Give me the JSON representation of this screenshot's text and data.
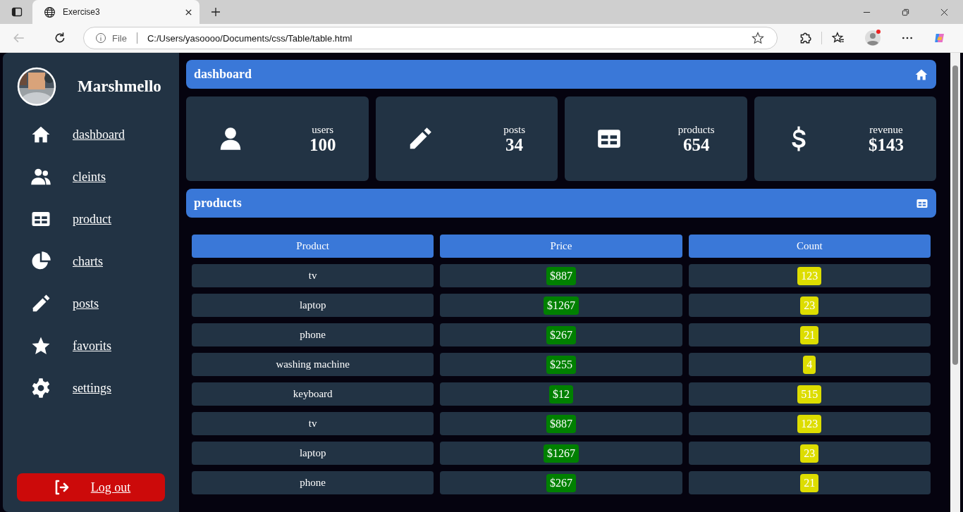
{
  "browser": {
    "tab_title": "Exercise3",
    "scheme": "File",
    "url": "C:/Users/yasoooo/Documents/css/Table/table.html"
  },
  "sidebar": {
    "user_name": "Marshmello",
    "items": [
      {
        "label": "dashboard"
      },
      {
        "label": "cleints"
      },
      {
        "label": "product"
      },
      {
        "label": "charts"
      },
      {
        "label": "posts"
      },
      {
        "label": "favorits"
      },
      {
        "label": "settings"
      }
    ],
    "logout": "Log out"
  },
  "header": {
    "title": "dashboard"
  },
  "stats": [
    {
      "label": "users",
      "value": "100"
    },
    {
      "label": "posts",
      "value": "34"
    },
    {
      "label": "products",
      "value": "654"
    },
    {
      "label": "revenue",
      "value": "$143"
    }
  ],
  "products": {
    "title": "products",
    "columns": [
      "Product",
      "Price",
      "Count"
    ],
    "rows": [
      {
        "product": "tv",
        "price": "$887",
        "count": "123"
      },
      {
        "product": "laptop",
        "price": "$1267",
        "count": "23"
      },
      {
        "product": "phone",
        "price": "$267",
        "count": "21"
      },
      {
        "product": "washing machine",
        "price": "$255",
        "count": "4"
      },
      {
        "product": "keyboard",
        "price": "$12",
        "count": "515"
      },
      {
        "product": "tv",
        "price": "$887",
        "count": "123"
      },
      {
        "product": "laptop",
        "price": "$1267",
        "count": "23"
      },
      {
        "product": "phone",
        "price": "$267",
        "count": "21"
      }
    ]
  }
}
